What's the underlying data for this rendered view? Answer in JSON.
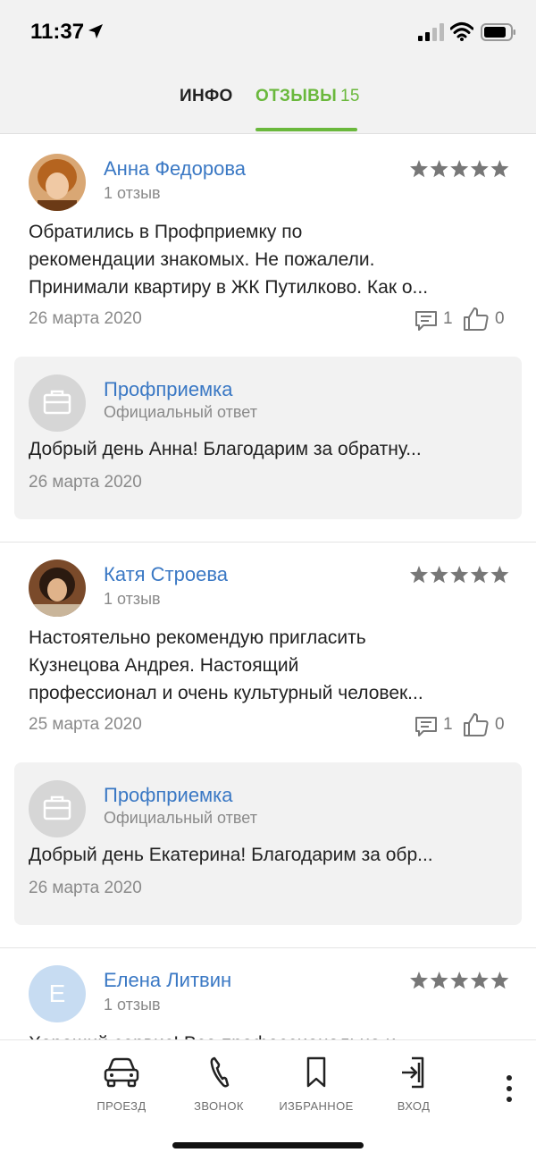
{
  "status_bar": {
    "time": "11:37"
  },
  "tabs": [
    {
      "label": "ИНФО"
    },
    {
      "label": "ОТЗЫВЫ",
      "count": "15"
    }
  ],
  "reviews": [
    {
      "author": "Анна Федорова",
      "sub": "1 отзыв",
      "rating": 5,
      "text_lines": [
        "Обратились в Профприемку по",
        "рекомендации знакомых. Не пожалели.",
        "Принимали квартиру в ЖК Путилково. Как о..."
      ],
      "date": "26 марта 2020",
      "comments": "1",
      "likes": "0",
      "reply": {
        "name": "Профприемка",
        "sub": "Официальный ответ",
        "text": "Добрый день Анна! Благодарим за обратну...",
        "date": "26 марта 2020"
      }
    },
    {
      "author": "Катя Строева",
      "sub": "1 отзыв",
      "rating": 5,
      "text_lines": [
        "Настоятельно рекомендую пригласить",
        "Кузнецова Андрея. Настоящий",
        "профессионал и очень культурный человек..."
      ],
      "date": "25 марта 2020",
      "comments": "1",
      "likes": "0",
      "reply": {
        "name": "Профприемка",
        "sub": "Официальный ответ",
        "text": "Добрый день Екатерина! Благодарим за обр...",
        "date": "26 марта 2020"
      }
    },
    {
      "author": "Елена Литвин",
      "sub": "1 отзыв",
      "rating": 5,
      "avatar_letter": "Е",
      "text_lines": [
        "Хороший сервис! Все профессионально и"
      ]
    }
  ],
  "bottom_nav": [
    {
      "label": "ПРОЕЗД",
      "icon": "car-icon"
    },
    {
      "label": "ЗВОНОК",
      "icon": "phone-icon"
    },
    {
      "label": "ИЗБРАННОЕ",
      "icon": "bookmark-icon"
    },
    {
      "label": "ВХОД",
      "icon": "login-icon"
    }
  ],
  "colors": {
    "accent_green": "#6ab83c",
    "link_blue": "#3a78c4",
    "star_grey": "#777777"
  }
}
